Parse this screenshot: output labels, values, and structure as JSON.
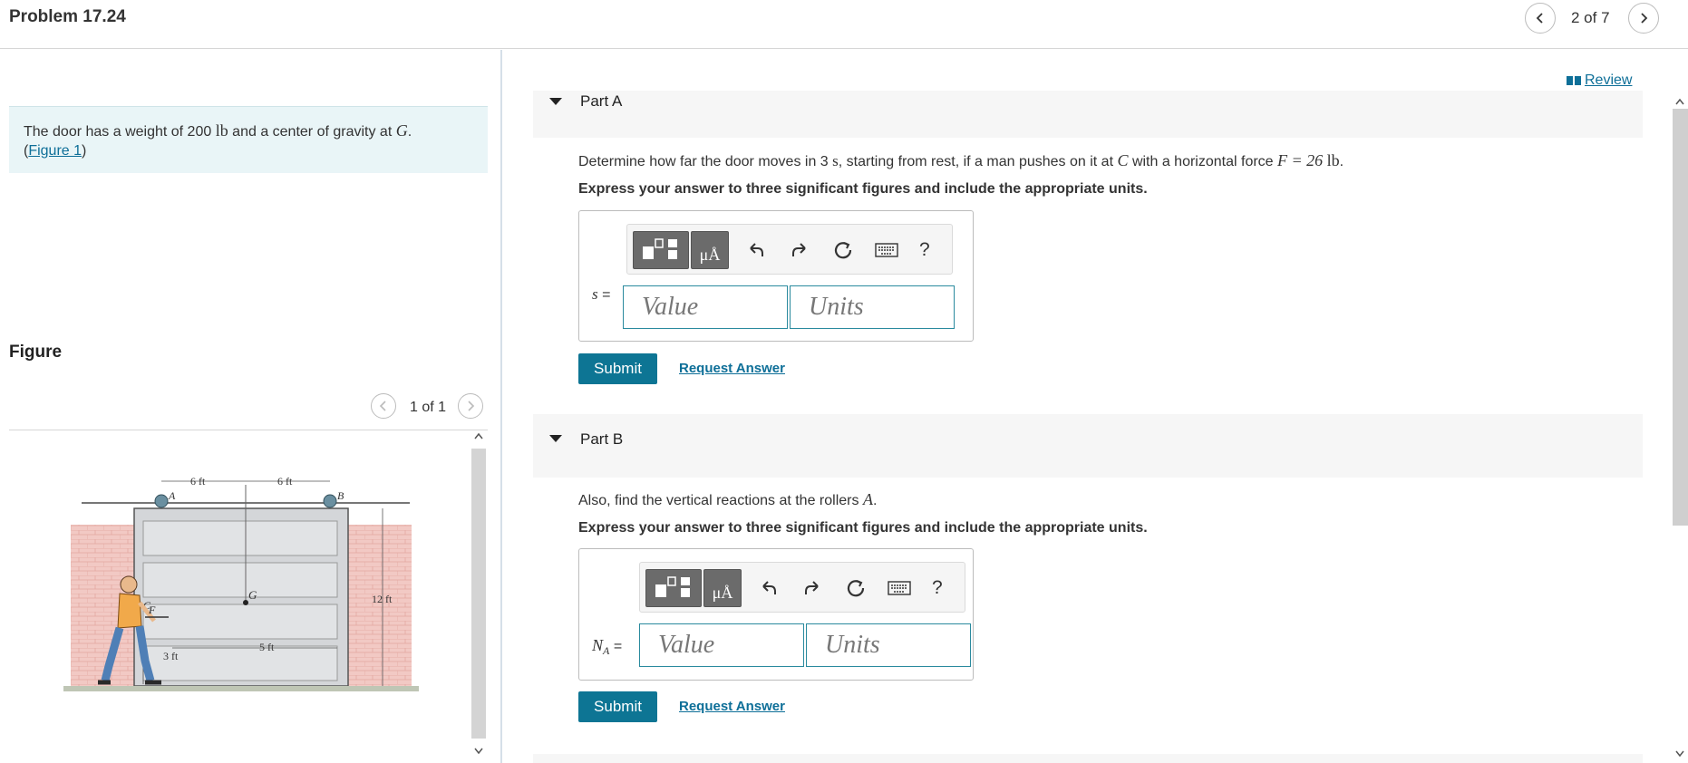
{
  "header": {
    "title": "Problem 17.24",
    "page_indicator": "2 of 7"
  },
  "problem": {
    "intro_prefix": "The door has a weight of 200",
    "weight_unit": "lb",
    "intro_middle": "and a center of gravity at",
    "cg_symbol": "G",
    "intro_end": ".",
    "figure_link_open": "(",
    "figure_link": "Figure 1",
    "figure_link_close": ")"
  },
  "figure": {
    "heading": "Figure",
    "page_indicator": "1 of 1",
    "labels": {
      "dim_a": "6 ft",
      "dim_b": "6 ft",
      "point_a": "A",
      "point_b": "B",
      "point_g": "G",
      "point_c": "C",
      "force_f": "F",
      "height": "12 ft",
      "dim_c": "3 ft",
      "dim_d": "5 ft"
    }
  },
  "review_link": "Review",
  "parts": [
    {
      "label": "Part A",
      "question_prefix": "Determine how far the door moves in 3",
      "time_unit": "s",
      "question_middle": ", starting from rest, if a man pushes on it at",
      "point": "C",
      "question_force": "with a horizontal force",
      "force_expr": "F = 26",
      "force_unit": "lb",
      "question_end": ".",
      "instruction": "Express your answer to three significant figures and include the appropriate units.",
      "variable": "s",
      "equals": "=",
      "value_placeholder": "Value",
      "units_placeholder": "Units",
      "submit_label": "Submit",
      "request_label": "Request Answer"
    },
    {
      "label": "Part B",
      "question_prefix": "Also, find the vertical reactions at the rollers",
      "point": "A",
      "question_end": ".",
      "instruction": "Express your answer to three significant figures and include the appropriate units.",
      "variable": "N",
      "subscript": "A",
      "equals": "=",
      "value_placeholder": "Value",
      "units_placeholder": "Units",
      "submit_label": "Submit",
      "request_label": "Request Answer"
    }
  ],
  "toolbar": {
    "units_button": "μÅ",
    "help_button": "?"
  },
  "colors": {
    "accent": "#0d7594",
    "link": "#0e6f98",
    "intro_bg": "#e9f5f7",
    "field_border": "#2a8a9e"
  }
}
